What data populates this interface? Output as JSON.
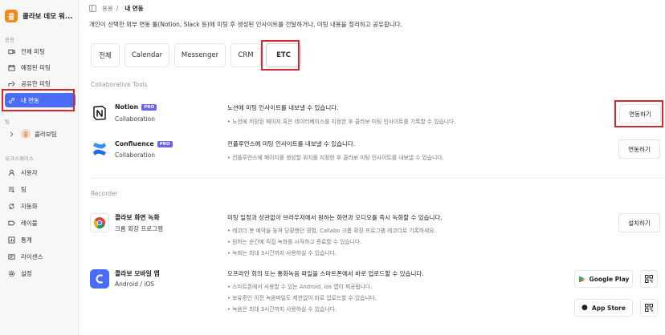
{
  "sidebar": {
    "workspace_logo": "콜",
    "workspace_name": "콜라보 데모 워...",
    "section_usage": "용용",
    "items": [
      {
        "label": "전체 미팅",
        "icon": "video-icon"
      },
      {
        "label": "예정된 미팅",
        "icon": "calendar-icon"
      },
      {
        "label": "공유한 미팅",
        "icon": "share-icon"
      },
      {
        "label": "내 연동",
        "icon": "link-icon"
      }
    ],
    "section_team": "팀",
    "team": {
      "avatar": "콜",
      "label": "콜라보팀"
    },
    "section_workspace": "워크스페이스",
    "ws_items": [
      {
        "label": "사용자",
        "icon": "user-icon"
      },
      {
        "label": "팀",
        "icon": "team-icon"
      },
      {
        "label": "자동화",
        "icon": "automation-icon"
      },
      {
        "label": "레이블",
        "icon": "label-icon"
      },
      {
        "label": "통계",
        "icon": "chart-icon"
      },
      {
        "label": "라이센스",
        "icon": "license-icon"
      },
      {
        "label": "설정",
        "icon": "gear-icon"
      }
    ]
  },
  "breadcrumb": {
    "parent": "용용",
    "separator": "/",
    "current": "내 연동"
  },
  "description": "개인이 선택한 외부 연동 툴(Notion, Slack 등)에 미팅 후 생성된 인사이트를 전달하거나, 미팅 내용을 정리하고 공유합니다.",
  "tabs": [
    "전체",
    "Calendar",
    "Messenger",
    "CRM",
    "ETC"
  ],
  "active_tab": "ETC",
  "groups": {
    "collab": "Collaborative Tools",
    "recorder": "Recorder"
  },
  "integrations": [
    {
      "name": "Notion",
      "badge": "PRO",
      "sub": "Collaboration",
      "head": "노션에 미팅 인사이트를 내보낼 수 있습니다.",
      "bullets": [
        "• 노션에 저장된 페이지 혹은 데이터베이스를 지정한 후 콜라보 미팅 인사이트를 기록할 수 있습니다."
      ],
      "button": "연동하기"
    },
    {
      "name": "Confluence",
      "badge": "PRO",
      "sub": "Collaboration",
      "head": "컨플루언스에 미팅 인사이트를 내보낼 수 있습니다.",
      "bullets": [
        "• 컨플루언스에 페이지를 생성할 위치를 지정한 후 콜라보 미팅 인사이트를 내보낼 수 있습니다."
      ],
      "button": "연동하기"
    },
    {
      "name": "콜라보 화면 녹화",
      "badge": "",
      "sub": "크롬 확장 프로그램",
      "head": "미팅 일정과 상관없이 브라우저에서 원하는 화면과 오디오를 즉시 녹화할 수 있습니다.",
      "bullets": [
        "• 레코더 봇 예약을 놓쳐 당황했던 경험, Callabo 크롬 확장 프로그램 레코더로 기록하세요.",
        "• 원하는 순간에 직접 녹화를 시작하고 종료할 수 있습니다.",
        "• 녹화는 최대 3시간까지 사용하실 수 있습니다."
      ],
      "button": "설치하기"
    },
    {
      "name": "콜라보 모바일 앱",
      "badge": "",
      "sub": "Android / iOS",
      "head": "오프라인 회의 또는 통화녹음 파일을 스마트폰에서 바로 업로드할 수 있습니다.",
      "bullets": [
        "• 스마트폰에서 사용할 수 있는 Android, ios 앱이 제공됩니다.",
        "• 보유중인 이전 녹음파일도 제한없이 바로 업로드할 수 있습니다.",
        "• 녹음은 최대 3시간까지 사용하실 수 있습니다."
      ],
      "button": ""
    }
  ],
  "stores": {
    "google": "Google Play",
    "apple": "App Store"
  },
  "colors": {
    "accent": "#4a6cf7",
    "highlight": "#d7262e",
    "pro": "#6b63e8",
    "brand": "#f08a1c"
  }
}
